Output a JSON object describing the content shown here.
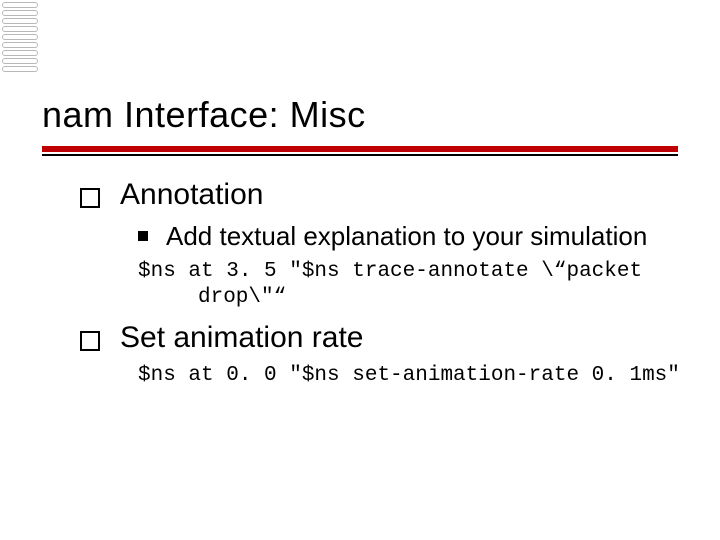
{
  "title": "nam Interface: Misc",
  "sections": [
    {
      "heading": "Annotation",
      "sub": "Add textual explanation to your simulation",
      "code_line1": "$ns at 3. 5 \"$ns trace-annotate \\“packet",
      "code_line2": "drop\\\"“"
    },
    {
      "heading": "Set animation rate",
      "code_line1": "$ns at 0. 0 \"$ns set-animation-rate 0. 1ms\""
    }
  ]
}
